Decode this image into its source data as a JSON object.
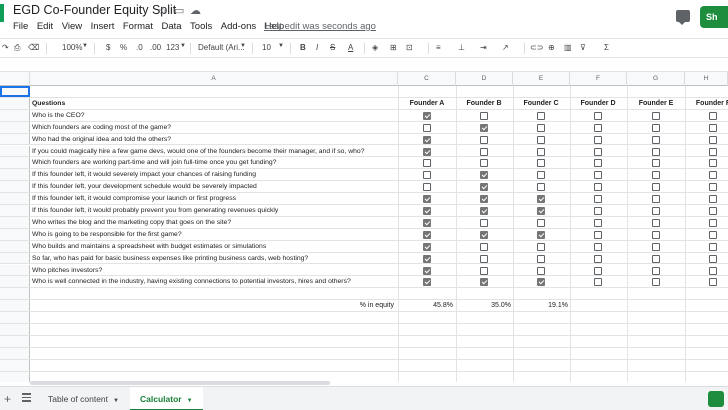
{
  "app": {
    "title": "EGD Co-Founder Equity Split",
    "last_edit": "Last edit was seconds ago",
    "share_label": "Sh"
  },
  "menu": [
    "File",
    "Edit",
    "View",
    "Insert",
    "Format",
    "Data",
    "Tools",
    "Add-ons",
    "Help"
  ],
  "toolbar": {
    "zoom": "100%",
    "currency": "$",
    "percent": "%",
    "dec_less": ".0",
    "dec_more": ".00",
    "more_formats": "123",
    "font": "Default (Ari...",
    "font_size": "10"
  },
  "columns": [
    "A",
    "B",
    "C",
    "D",
    "E",
    "F",
    "G",
    "H"
  ],
  "table": {
    "questions_header": "Questions",
    "founders": [
      "Founder A",
      "Founder B",
      "Founder C",
      "Founder D",
      "Founder E",
      "Founder F"
    ],
    "rows": [
      {
        "q": "Who is the CEO?",
        "checks": [
          true,
          false,
          false,
          false,
          false,
          false
        ]
      },
      {
        "q": "Which founders are coding most of the game?",
        "checks": [
          false,
          true,
          false,
          false,
          false,
          false
        ]
      },
      {
        "q": "Who had the original idea and told the others?",
        "checks": [
          true,
          false,
          false,
          false,
          false,
          false
        ]
      },
      {
        "q": "If you could magically hire a few game devs, would one of the founders become their manager, and if so, who?",
        "checks": [
          true,
          false,
          false,
          false,
          false,
          false
        ]
      },
      {
        "q": "Which founders are working part-time and will join full-time once you get funding?",
        "checks": [
          false,
          false,
          false,
          false,
          false,
          false
        ]
      },
      {
        "q": "If this founder left, it would severely impact your chances of raising funding",
        "checks": [
          false,
          true,
          false,
          false,
          false,
          false
        ]
      },
      {
        "q": "If this founder left, your development schedule would be severely impacted",
        "checks": [
          false,
          true,
          false,
          false,
          false,
          false
        ]
      },
      {
        "q": "If this founder left, it would compromise your launch or first progress",
        "checks": [
          true,
          true,
          true,
          false,
          false,
          false
        ]
      },
      {
        "q": "If this founder left, it would probably prevent you from generating revenues quickly",
        "checks": [
          true,
          true,
          true,
          false,
          false,
          false
        ]
      },
      {
        "q": "Who writes the blog and the marketing copy that goes on the site?",
        "checks": [
          true,
          false,
          false,
          false,
          false,
          false
        ]
      },
      {
        "q": "Who is going to be responsible for the first game?",
        "checks": [
          true,
          true,
          true,
          false,
          false,
          false
        ]
      },
      {
        "q": "Who builds and maintains a spreadsheet with budget estimates or simulations",
        "checks": [
          true,
          false,
          false,
          false,
          false,
          false
        ]
      },
      {
        "q": "So far, who has paid for basic business expenses like printing business cards, web hosting?",
        "checks": [
          true,
          false,
          false,
          false,
          false,
          false
        ]
      },
      {
        "q": "Who pitches investors?",
        "checks": [
          true,
          false,
          false,
          false,
          false,
          false
        ]
      },
      {
        "q": "Who is well connected in the industry, having existing connections to potential investors, hires and others?",
        "checks": [
          true,
          true,
          true,
          false,
          false,
          false
        ]
      }
    ],
    "equity_label": "% in equity",
    "equity": [
      "45.8%",
      "35.0%",
      "19.1%"
    ]
  },
  "sheets": {
    "tabs": [
      "Table of content",
      "Calculator"
    ],
    "active": "Calculator"
  },
  "colors": {
    "accent": "#1a73e8",
    "brand_green": "#1e8e3e",
    "checked": "#757575"
  }
}
